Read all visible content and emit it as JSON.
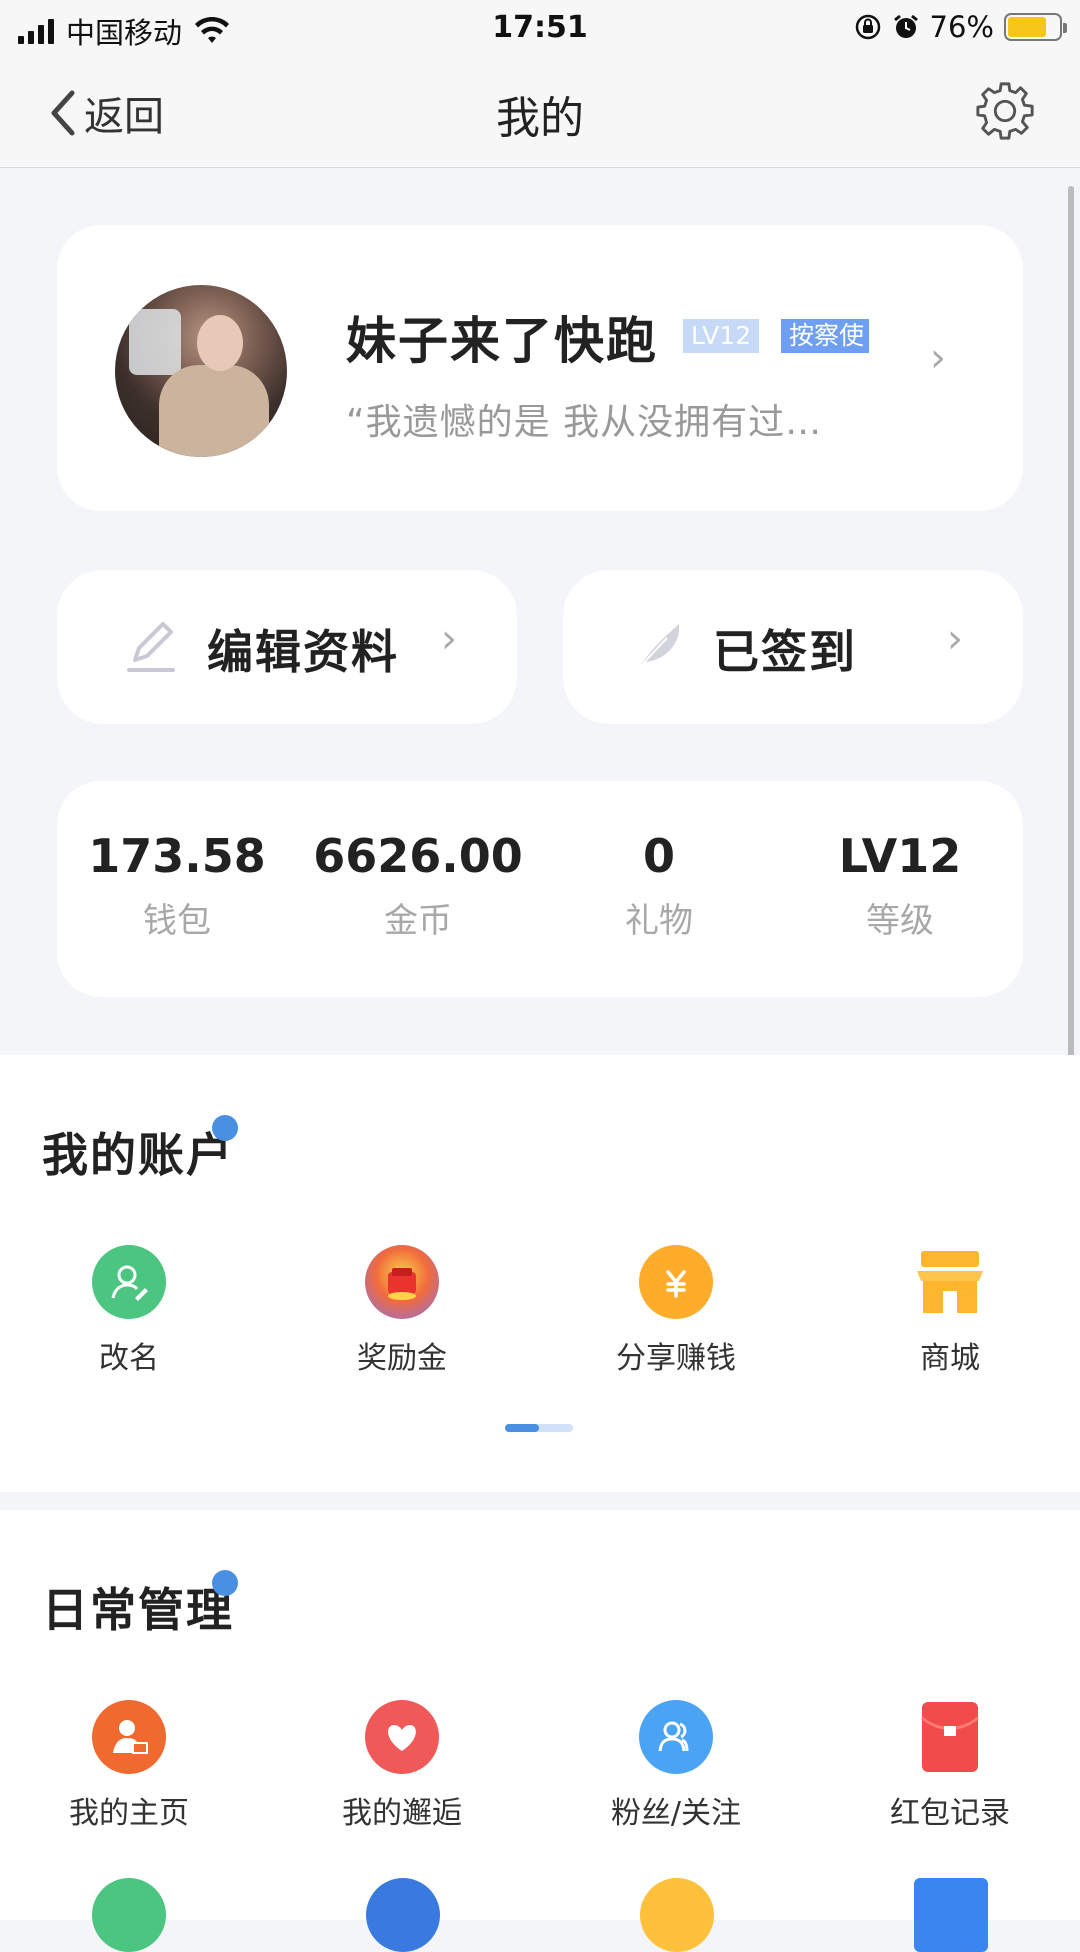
{
  "statusbar": {
    "carrier": "中国移动",
    "time": "17:51",
    "battery": "76%",
    "battery_level": 0.76
  },
  "nav": {
    "back_label": "返回",
    "title": "我的"
  },
  "profile": {
    "username": "妹子来了快跑",
    "level_badge": "LV12",
    "role_badge": "按察使",
    "signature": "“我遗憾的是 我从没拥有过…"
  },
  "actions": {
    "edit_label": "编辑资料",
    "signin_label": "已签到"
  },
  "stats": [
    {
      "value": "173.58",
      "label": "钱包"
    },
    {
      "value": "6626.00",
      "label": "金币"
    },
    {
      "value": "0",
      "label": "礼物"
    },
    {
      "value": "LV12",
      "label": "等级"
    }
  ],
  "account": {
    "title": "我的账户",
    "items": [
      {
        "label": "改名",
        "icon": "rename-icon",
        "color": "#4cc580"
      },
      {
        "label": "奖励金",
        "icon": "reward-gift-icon",
        "color": "#f04b3a"
      },
      {
        "label": "分享赚钱",
        "icon": "share-yuan-icon",
        "color": "#ffac2a"
      },
      {
        "label": "商城",
        "icon": "store-icon",
        "color": "#ffb52e"
      }
    ]
  },
  "daily": {
    "title": "日常管理",
    "items": [
      {
        "label": "我的主页",
        "icon": "homepage-user-icon",
        "color": "#f06a30"
      },
      {
        "label": "我的邂逅",
        "icon": "hearts-icon",
        "color": "#ef5a58"
      },
      {
        "label": "粉丝/关注",
        "icon": "fans-icon",
        "color": "#4aa3f3"
      },
      {
        "label": "红包记录",
        "icon": "red-packet-icon",
        "color": "#f24b4b"
      }
    ]
  },
  "colors": {
    "accent": "#4a90e2",
    "badge_light": "#c6d9f7",
    "badge_dark": "#6f9ff0"
  }
}
